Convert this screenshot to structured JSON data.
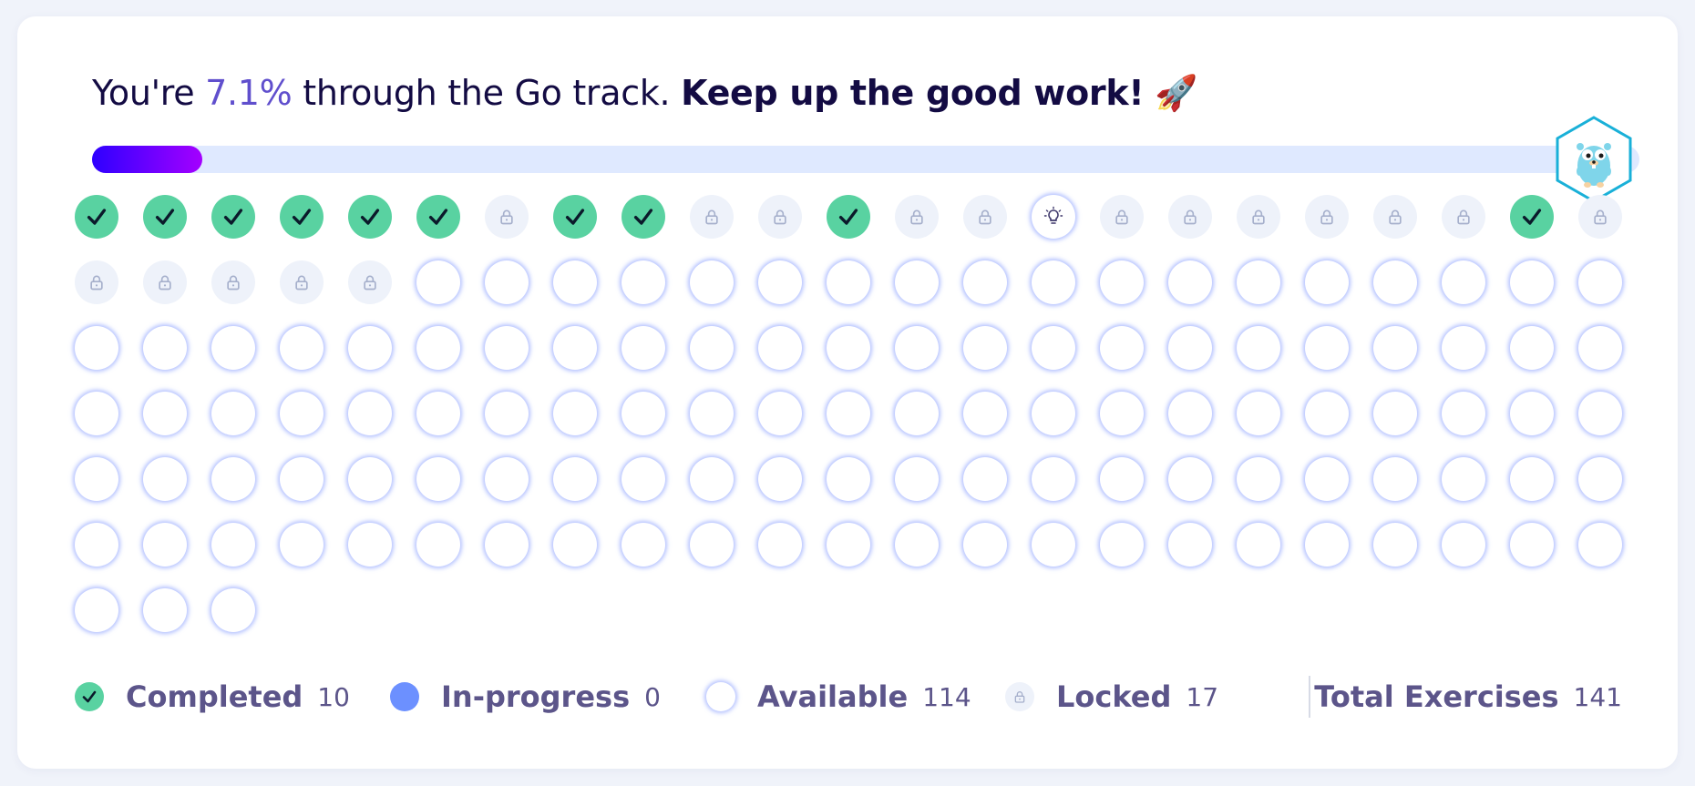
{
  "headline": {
    "prefix": "You're ",
    "percent": "7.1%",
    "middle": " through the Go track. ",
    "encouragement": "Keep up the good work!",
    "emoji": "🚀"
  },
  "progress": {
    "fraction": 0.071,
    "gradient_start": "#2e00ff",
    "gradient_end": "#a400ff",
    "track_color": "#dfe9ff"
  },
  "track_badge": {
    "icon": "go-gopher-icon",
    "border_color": "#19b0d8"
  },
  "exercises": [
    "completed",
    "completed",
    "completed",
    "completed",
    "completed",
    "completed",
    "locked",
    "completed",
    "completed",
    "locked",
    "locked",
    "completed",
    "locked",
    "locked",
    "current",
    "locked",
    "locked",
    "locked",
    "locked",
    "locked",
    "locked",
    "completed",
    "locked",
    "locked",
    "locked",
    "locked",
    "locked",
    "locked",
    "available",
    "available",
    "available",
    "available",
    "available",
    "available",
    "available",
    "available",
    "available",
    "available",
    "available",
    "available",
    "available",
    "available",
    "available",
    "available",
    "available",
    "available",
    "available",
    "available",
    "available",
    "available",
    "available",
    "available",
    "available",
    "available",
    "available",
    "available",
    "available",
    "available",
    "available",
    "available",
    "available",
    "available",
    "available",
    "available",
    "available",
    "available",
    "available",
    "available",
    "available",
    "available",
    "available",
    "available",
    "available",
    "available",
    "available",
    "available",
    "available",
    "available",
    "available",
    "available",
    "available",
    "available",
    "available",
    "available",
    "available",
    "available",
    "available",
    "available",
    "available",
    "available",
    "available",
    "available",
    "available",
    "available",
    "available",
    "available",
    "available",
    "available",
    "available",
    "available",
    "available",
    "available",
    "available",
    "available",
    "available",
    "available",
    "available",
    "available",
    "available",
    "available",
    "available",
    "available",
    "available",
    "available",
    "available",
    "available",
    "available",
    "available",
    "available",
    "available",
    "available",
    "available",
    "available",
    "available",
    "available",
    "available",
    "available",
    "available",
    "available",
    "available",
    "available",
    "available",
    "available",
    "available",
    "available",
    "available",
    "available",
    "available",
    "available",
    "available",
    "available"
  ],
  "legend": {
    "completed": {
      "label": "Completed",
      "count": "10",
      "icon": "check-icon",
      "color": "#59d2a1"
    },
    "in_progress": {
      "label": "In-progress",
      "count": "0",
      "icon": "dot-icon",
      "color": "#6c90ff"
    },
    "available": {
      "label": "Available",
      "count": "114",
      "icon": "circle-icon"
    },
    "locked": {
      "label": "Locked",
      "count": "17",
      "icon": "lock-icon"
    },
    "total": {
      "label": "Total Exercises",
      "count": "141"
    }
  }
}
